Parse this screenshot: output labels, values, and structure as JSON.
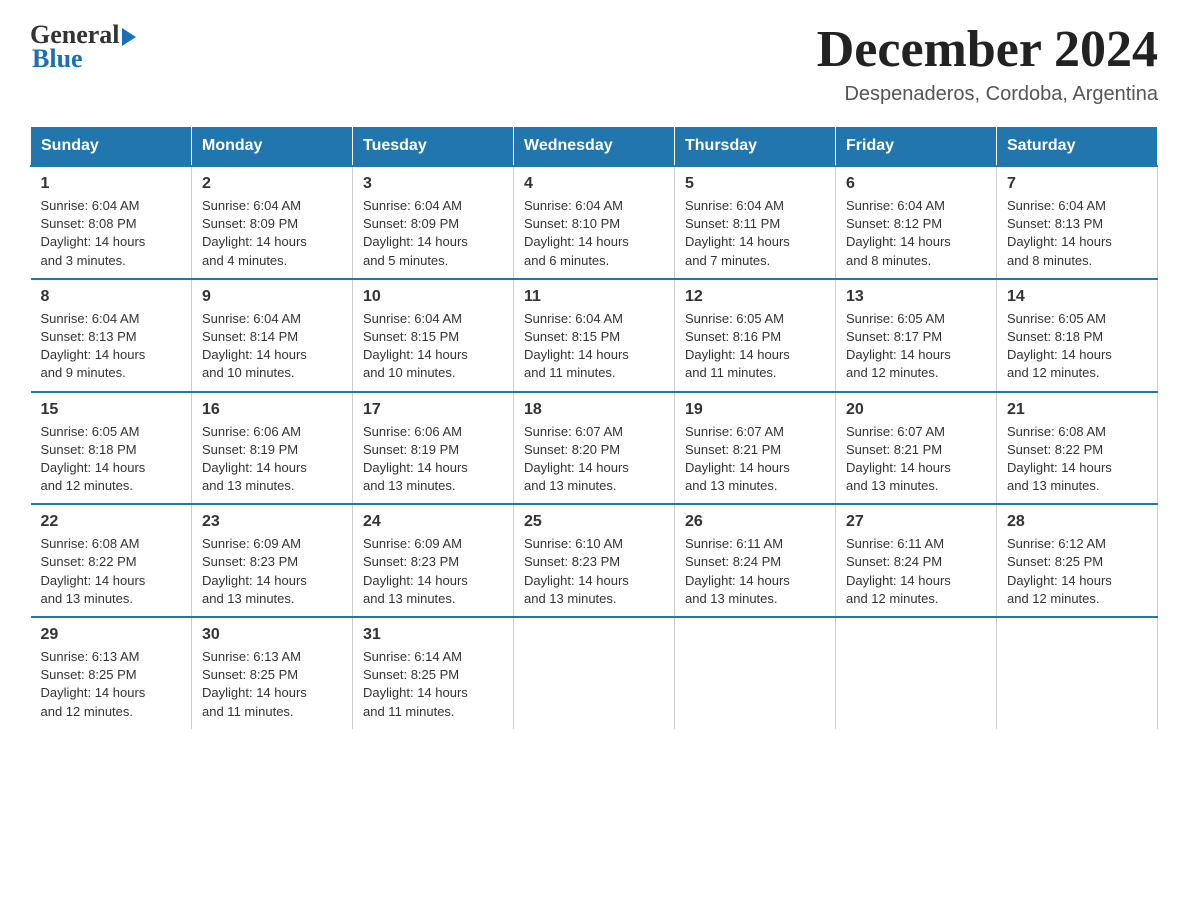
{
  "header": {
    "logo_general": "General",
    "logo_blue": "Blue",
    "month_title": "December 2024",
    "location": "Despenaderos, Cordoba, Argentina"
  },
  "weekdays": [
    "Sunday",
    "Monday",
    "Tuesday",
    "Wednesday",
    "Thursday",
    "Friday",
    "Saturday"
  ],
  "weeks": [
    [
      {
        "day": "1",
        "sunrise": "6:04 AM",
        "sunset": "8:08 PM",
        "daylight": "14 hours and 3 minutes."
      },
      {
        "day": "2",
        "sunrise": "6:04 AM",
        "sunset": "8:09 PM",
        "daylight": "14 hours and 4 minutes."
      },
      {
        "day": "3",
        "sunrise": "6:04 AM",
        "sunset": "8:09 PM",
        "daylight": "14 hours and 5 minutes."
      },
      {
        "day": "4",
        "sunrise": "6:04 AM",
        "sunset": "8:10 PM",
        "daylight": "14 hours and 6 minutes."
      },
      {
        "day": "5",
        "sunrise": "6:04 AM",
        "sunset": "8:11 PM",
        "daylight": "14 hours and 7 minutes."
      },
      {
        "day": "6",
        "sunrise": "6:04 AM",
        "sunset": "8:12 PM",
        "daylight": "14 hours and 8 minutes."
      },
      {
        "day": "7",
        "sunrise": "6:04 AM",
        "sunset": "8:13 PM",
        "daylight": "14 hours and 8 minutes."
      }
    ],
    [
      {
        "day": "8",
        "sunrise": "6:04 AM",
        "sunset": "8:13 PM",
        "daylight": "14 hours and 9 minutes."
      },
      {
        "day": "9",
        "sunrise": "6:04 AM",
        "sunset": "8:14 PM",
        "daylight": "14 hours and 10 minutes."
      },
      {
        "day": "10",
        "sunrise": "6:04 AM",
        "sunset": "8:15 PM",
        "daylight": "14 hours and 10 minutes."
      },
      {
        "day": "11",
        "sunrise": "6:04 AM",
        "sunset": "8:15 PM",
        "daylight": "14 hours and 11 minutes."
      },
      {
        "day": "12",
        "sunrise": "6:05 AM",
        "sunset": "8:16 PM",
        "daylight": "14 hours and 11 minutes."
      },
      {
        "day": "13",
        "sunrise": "6:05 AM",
        "sunset": "8:17 PM",
        "daylight": "14 hours and 12 minutes."
      },
      {
        "day": "14",
        "sunrise": "6:05 AM",
        "sunset": "8:18 PM",
        "daylight": "14 hours and 12 minutes."
      }
    ],
    [
      {
        "day": "15",
        "sunrise": "6:05 AM",
        "sunset": "8:18 PM",
        "daylight": "14 hours and 12 minutes."
      },
      {
        "day": "16",
        "sunrise": "6:06 AM",
        "sunset": "8:19 PM",
        "daylight": "14 hours and 13 minutes."
      },
      {
        "day": "17",
        "sunrise": "6:06 AM",
        "sunset": "8:19 PM",
        "daylight": "14 hours and 13 minutes."
      },
      {
        "day": "18",
        "sunrise": "6:07 AM",
        "sunset": "8:20 PM",
        "daylight": "14 hours and 13 minutes."
      },
      {
        "day": "19",
        "sunrise": "6:07 AM",
        "sunset": "8:21 PM",
        "daylight": "14 hours and 13 minutes."
      },
      {
        "day": "20",
        "sunrise": "6:07 AM",
        "sunset": "8:21 PM",
        "daylight": "14 hours and 13 minutes."
      },
      {
        "day": "21",
        "sunrise": "6:08 AM",
        "sunset": "8:22 PM",
        "daylight": "14 hours and 13 minutes."
      }
    ],
    [
      {
        "day": "22",
        "sunrise": "6:08 AM",
        "sunset": "8:22 PM",
        "daylight": "14 hours and 13 minutes."
      },
      {
        "day": "23",
        "sunrise": "6:09 AM",
        "sunset": "8:23 PM",
        "daylight": "14 hours and 13 minutes."
      },
      {
        "day": "24",
        "sunrise": "6:09 AM",
        "sunset": "8:23 PM",
        "daylight": "14 hours and 13 minutes."
      },
      {
        "day": "25",
        "sunrise": "6:10 AM",
        "sunset": "8:23 PM",
        "daylight": "14 hours and 13 minutes."
      },
      {
        "day": "26",
        "sunrise": "6:11 AM",
        "sunset": "8:24 PM",
        "daylight": "14 hours and 13 minutes."
      },
      {
        "day": "27",
        "sunrise": "6:11 AM",
        "sunset": "8:24 PM",
        "daylight": "14 hours and 12 minutes."
      },
      {
        "day": "28",
        "sunrise": "6:12 AM",
        "sunset": "8:25 PM",
        "daylight": "14 hours and 12 minutes."
      }
    ],
    [
      {
        "day": "29",
        "sunrise": "6:13 AM",
        "sunset": "8:25 PM",
        "daylight": "14 hours and 12 minutes."
      },
      {
        "day": "30",
        "sunrise": "6:13 AM",
        "sunset": "8:25 PM",
        "daylight": "14 hours and 11 minutes."
      },
      {
        "day": "31",
        "sunrise": "6:14 AM",
        "sunset": "8:25 PM",
        "daylight": "14 hours and 11 minutes."
      },
      null,
      null,
      null,
      null
    ]
  ],
  "labels": {
    "sunrise": "Sunrise:",
    "sunset": "Sunset:",
    "daylight": "Daylight:"
  }
}
